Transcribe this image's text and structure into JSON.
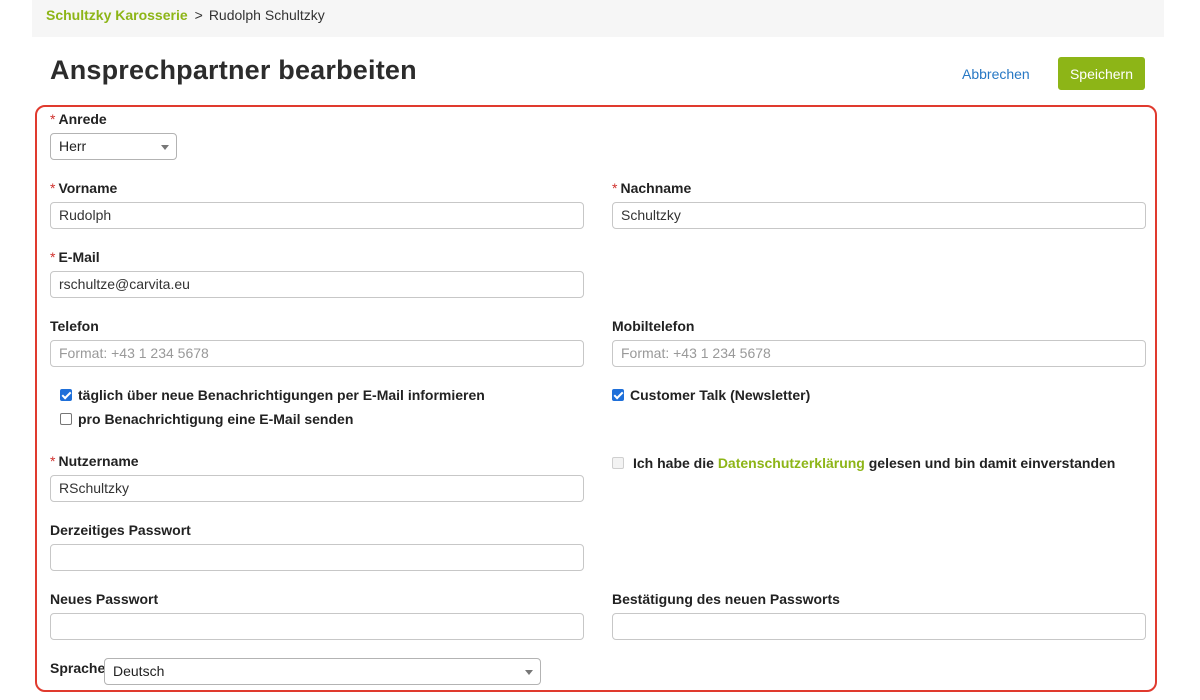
{
  "breadcrumb": {
    "company": "Schultzky Karosserie",
    "separator": ">",
    "current": "Rudolph Schultzky"
  },
  "header": {
    "title": "Ansprechpartner bearbeiten",
    "cancel_label": "Abbrechen",
    "save_label": "Speichern"
  },
  "form": {
    "required_marker": "*",
    "salutation": {
      "label": "Anrede",
      "value": "Herr"
    },
    "first_name": {
      "label": "Vorname",
      "value": "Rudolph"
    },
    "last_name": {
      "label": "Nachname",
      "value": "Schultzky"
    },
    "email": {
      "label": "E-Mail",
      "value": "rschultze@carvita.eu"
    },
    "phone": {
      "label": "Telefon",
      "value": "",
      "placeholder": "Format: +43 1 234 5678"
    },
    "mobile": {
      "label": "Mobiltelefon",
      "value": "",
      "placeholder": "Format: +43 1 234 5678"
    },
    "checkboxes": {
      "daily_email": {
        "label": "täglich über neue Benachrichtigungen per E-Mail informieren",
        "checked": true
      },
      "per_notification": {
        "label": "pro Benachrichtigung eine E-Mail senden",
        "checked": false
      },
      "newsletter": {
        "label": "Customer Talk (Newsletter)",
        "checked": true
      },
      "privacy": {
        "label_before": "Ich habe die",
        "link": "Datenschutzerklärung",
        "label_after": "gelesen und bin damit einverstanden",
        "checked": false
      }
    },
    "username": {
      "label": "Nutzername",
      "value": "RSchultzky"
    },
    "current_password": {
      "label": "Derzeitiges Passwort",
      "value": ""
    },
    "new_password": {
      "label": "Neues Passwort",
      "value": ""
    },
    "confirm_password": {
      "label": "Bestätigung des neuen Passworts",
      "value": ""
    },
    "language": {
      "label": "Sprache",
      "value": "Deutsch"
    }
  },
  "colors": {
    "brand": "#8db517",
    "link": "#2778c4",
    "required": "#d0312d",
    "highlight_border": "#e03a2e",
    "checkbox": "#1e6fd9"
  }
}
